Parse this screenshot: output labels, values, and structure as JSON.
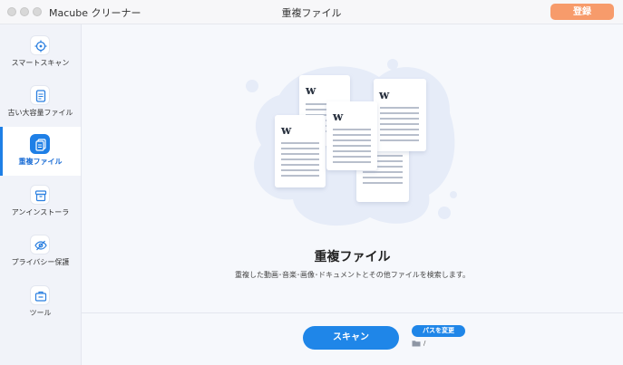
{
  "app": {
    "name": "Macube クリーナー",
    "window_title": "重複ファイル",
    "register_label": "登録"
  },
  "sidebar": {
    "items": [
      {
        "label": "スマートスキャン",
        "icon": "target-icon",
        "active": false
      },
      {
        "label": "古い大容量ファイル",
        "icon": "document-icon",
        "active": false
      },
      {
        "label": "重複ファイル",
        "icon": "duplicate-files-icon",
        "active": true
      },
      {
        "label": "アンインストーラ",
        "icon": "package-box-icon",
        "active": false
      },
      {
        "label": "プライバシー保護",
        "icon": "eye-slash-icon",
        "active": false
      },
      {
        "label": "ツール",
        "icon": "toolbox-icon",
        "active": false
      }
    ]
  },
  "main": {
    "heading": "重複ファイル",
    "description": "重複した動画･音楽･画像･ドキュメントとその他ファイルを検索します。",
    "scan_label": "スキャン",
    "path_button_label": "パスを変更",
    "path_value": "/"
  },
  "colors": {
    "accent": "#1f86e8",
    "register": "#f79b6b",
    "sidebar_bg": "#f1f3f9"
  }
}
